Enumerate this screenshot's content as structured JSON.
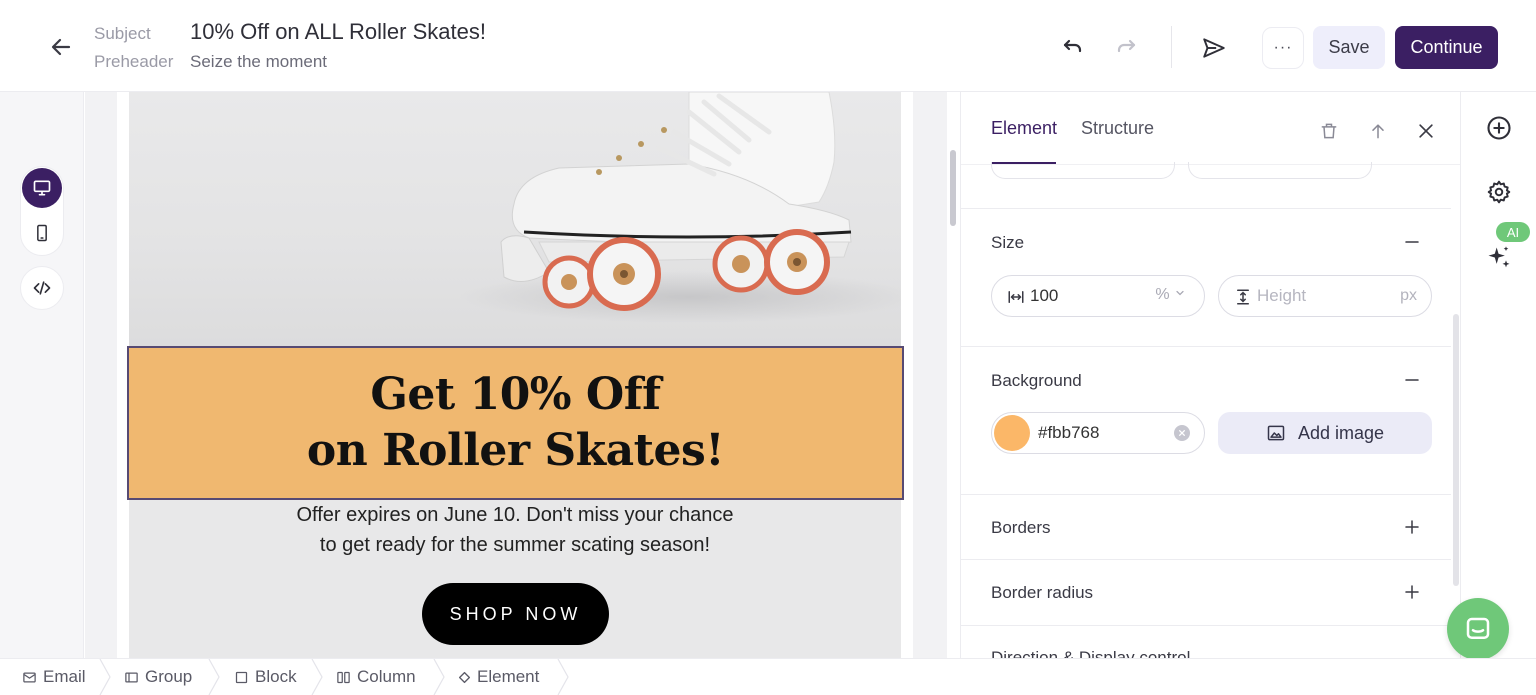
{
  "header": {
    "subject_label": "Subject",
    "subject_value": "10% Off on ALL Roller Skates!",
    "preheader_label": "Preheader",
    "preheader_value": "Seize the moment",
    "more_label": "···",
    "save_label": "Save",
    "continue_label": "Continue"
  },
  "email": {
    "banner_line1": "Get 10% Off",
    "banner_line2": "on Roller Skates!",
    "offer_line1": "Offer expires on June 10. Don't miss your chance",
    "offer_line2": "to get ready for the summer scating season!",
    "cta_label": "SHOP NOW",
    "banner_color": "#fbb768"
  },
  "panel": {
    "tabs": [
      {
        "label": "Element",
        "active": true
      },
      {
        "label": "Structure",
        "active": false
      }
    ],
    "size": {
      "title": "Size",
      "width_value": "100",
      "width_unit": "%",
      "height_placeholder": "Height",
      "height_unit": "px"
    },
    "background": {
      "title": "Background",
      "color_value": "#fbb768",
      "add_image_label": "Add image"
    },
    "sections": {
      "borders": "Borders",
      "border_radius": "Border radius",
      "direction": "Direction & Display control"
    }
  },
  "right_rail": {
    "ai_badge": "AI"
  },
  "breadcrumb": [
    {
      "label": "Email",
      "icon": "mail-icon"
    },
    {
      "label": "Group",
      "icon": "group-icon"
    },
    {
      "label": "Block",
      "icon": "block-icon"
    },
    {
      "label": "Column",
      "icon": "column-icon"
    },
    {
      "label": "Element",
      "icon": "element-icon"
    }
  ],
  "colors": {
    "accent": "#3b1f63",
    "banner": "#f0b870",
    "chat": "#6fc879"
  }
}
